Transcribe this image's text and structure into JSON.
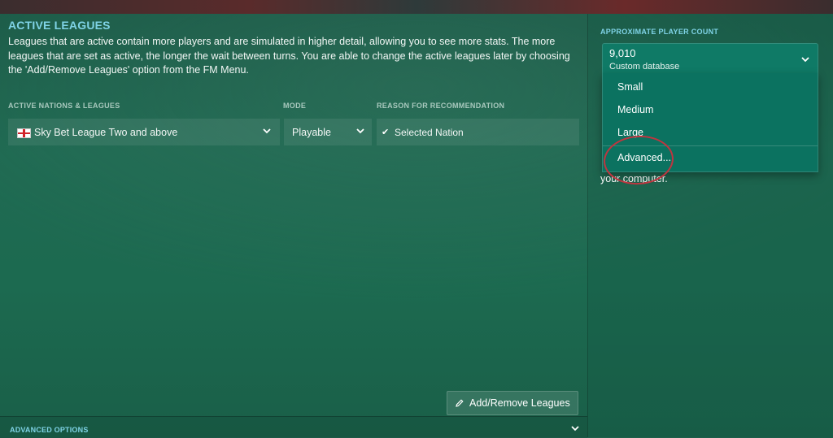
{
  "active_leagues": {
    "title": "ACTIVE LEAGUES",
    "description": "Leagues that are active contain more players and are simulated in higher detail, allowing you to see more stats. The more leagues that are set as active, the longer the wait between turns. You are able to change the active leagues later by choosing the 'Add/Remove Leagues' option from the FM Menu.",
    "columns": {
      "nations": "ACTIVE NATIONS & LEAGUES",
      "mode": "MODE",
      "reason": "REASON FOR RECOMMENDATION"
    },
    "rows": [
      {
        "league": "Sky Bet League Two and above",
        "mode": "Playable",
        "reason": "Selected Nation"
      }
    ],
    "add_remove_label": "Add/Remove Leagues",
    "advanced_options_label": "ADVANCED OPTIONS"
  },
  "player_count": {
    "title": "APPROXIMATE PLAYER COUNT",
    "selected_value": "9,010",
    "selected_sub": "Custom database",
    "options": [
      "Small",
      "Medium",
      "Large",
      "Advanced..."
    ],
    "peek_text": "your computer."
  },
  "icons": {
    "flag": "england-flag-icon",
    "chevron": "chevron-down-icon",
    "check": "check-icon",
    "pencil": "pencil-icon"
  },
  "colors": {
    "accent": "#7fd3e6",
    "dropdown_bg": "#0b7260",
    "highlight_circle": "#c0353f"
  }
}
